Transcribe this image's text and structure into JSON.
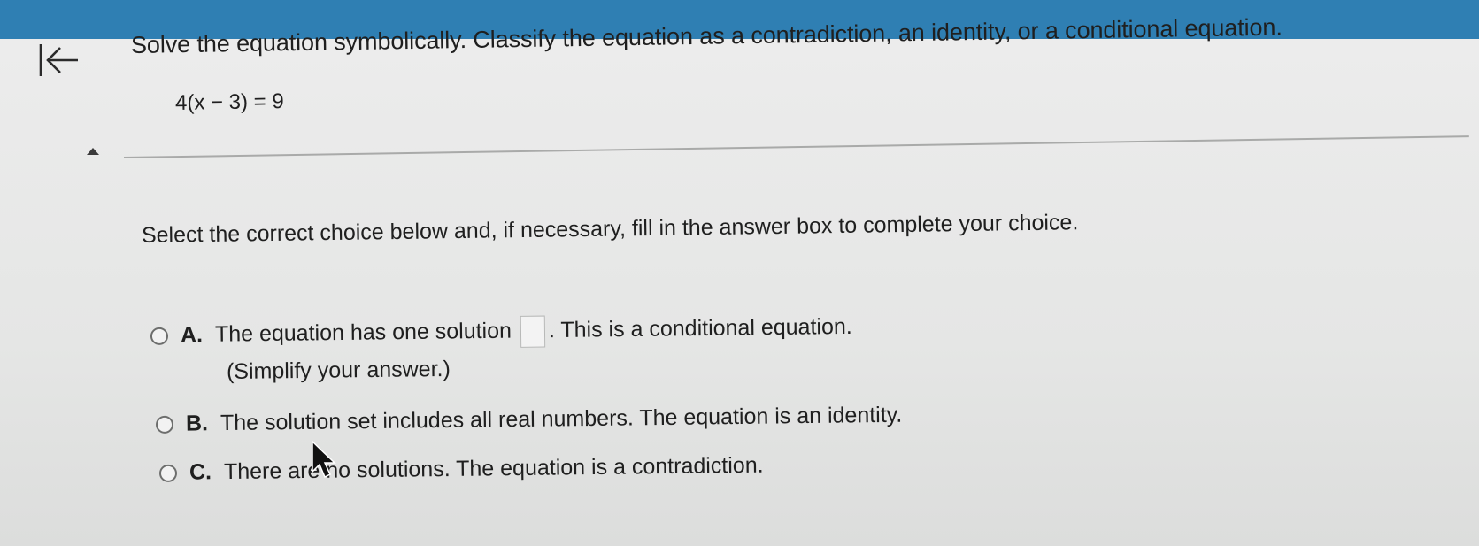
{
  "header": {
    "accent_color": "#2f7fb3"
  },
  "navigation": {
    "back_icon": "back-to-first-icon",
    "collapse_icon": "collapse-triangle-icon"
  },
  "question": {
    "prompt": "Solve the equation symbolically. Classify the equation as a contradiction, an identity, or a conditional equation.",
    "equation": "4(x − 3) = 9"
  },
  "answer": {
    "instruction": "Select the correct choice below and, if necessary, fill in the answer box to complete your choice.",
    "choices": [
      {
        "letter": "A.",
        "text_before": "The equation has one solution",
        "text_after": ". This is a conditional equation.",
        "note": "(Simplify your answer.)",
        "answer_value": ""
      },
      {
        "letter": "B.",
        "text": "The solution set includes all real numbers. The equation is an identity."
      },
      {
        "letter": "C.",
        "text": "There are no solutions. The equation is a contradiction."
      }
    ]
  }
}
